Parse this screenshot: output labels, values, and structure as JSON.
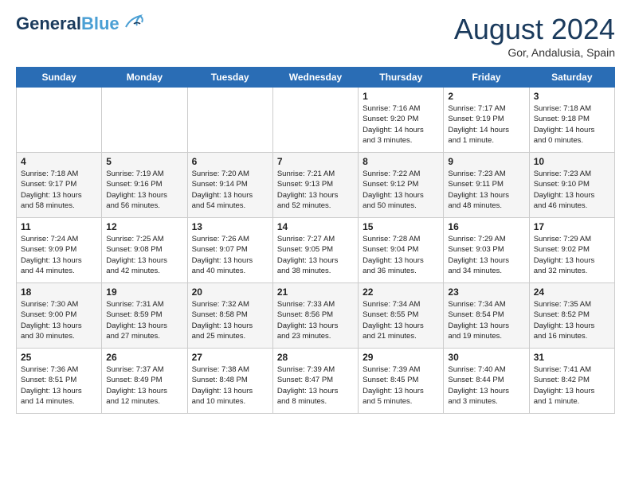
{
  "logo": {
    "general": "General",
    "blue": "Blue"
  },
  "title": {
    "month_year": "August 2024",
    "location": "Gor, Andalusia, Spain"
  },
  "days_of_week": [
    "Sunday",
    "Monday",
    "Tuesday",
    "Wednesday",
    "Thursday",
    "Friday",
    "Saturday"
  ],
  "weeks": [
    [
      {
        "day": "",
        "info": ""
      },
      {
        "day": "",
        "info": ""
      },
      {
        "day": "",
        "info": ""
      },
      {
        "day": "",
        "info": ""
      },
      {
        "day": "1",
        "info": "Sunrise: 7:16 AM\nSunset: 9:20 PM\nDaylight: 14 hours\nand 3 minutes."
      },
      {
        "day": "2",
        "info": "Sunrise: 7:17 AM\nSunset: 9:19 PM\nDaylight: 14 hours\nand 1 minute."
      },
      {
        "day": "3",
        "info": "Sunrise: 7:18 AM\nSunset: 9:18 PM\nDaylight: 14 hours\nand 0 minutes."
      }
    ],
    [
      {
        "day": "4",
        "info": "Sunrise: 7:18 AM\nSunset: 9:17 PM\nDaylight: 13 hours\nand 58 minutes."
      },
      {
        "day": "5",
        "info": "Sunrise: 7:19 AM\nSunset: 9:16 PM\nDaylight: 13 hours\nand 56 minutes."
      },
      {
        "day": "6",
        "info": "Sunrise: 7:20 AM\nSunset: 9:14 PM\nDaylight: 13 hours\nand 54 minutes."
      },
      {
        "day": "7",
        "info": "Sunrise: 7:21 AM\nSunset: 9:13 PM\nDaylight: 13 hours\nand 52 minutes."
      },
      {
        "day": "8",
        "info": "Sunrise: 7:22 AM\nSunset: 9:12 PM\nDaylight: 13 hours\nand 50 minutes."
      },
      {
        "day": "9",
        "info": "Sunrise: 7:23 AM\nSunset: 9:11 PM\nDaylight: 13 hours\nand 48 minutes."
      },
      {
        "day": "10",
        "info": "Sunrise: 7:23 AM\nSunset: 9:10 PM\nDaylight: 13 hours\nand 46 minutes."
      }
    ],
    [
      {
        "day": "11",
        "info": "Sunrise: 7:24 AM\nSunset: 9:09 PM\nDaylight: 13 hours\nand 44 minutes."
      },
      {
        "day": "12",
        "info": "Sunrise: 7:25 AM\nSunset: 9:08 PM\nDaylight: 13 hours\nand 42 minutes."
      },
      {
        "day": "13",
        "info": "Sunrise: 7:26 AM\nSunset: 9:07 PM\nDaylight: 13 hours\nand 40 minutes."
      },
      {
        "day": "14",
        "info": "Sunrise: 7:27 AM\nSunset: 9:05 PM\nDaylight: 13 hours\nand 38 minutes."
      },
      {
        "day": "15",
        "info": "Sunrise: 7:28 AM\nSunset: 9:04 PM\nDaylight: 13 hours\nand 36 minutes."
      },
      {
        "day": "16",
        "info": "Sunrise: 7:29 AM\nSunset: 9:03 PM\nDaylight: 13 hours\nand 34 minutes."
      },
      {
        "day": "17",
        "info": "Sunrise: 7:29 AM\nSunset: 9:02 PM\nDaylight: 13 hours\nand 32 minutes."
      }
    ],
    [
      {
        "day": "18",
        "info": "Sunrise: 7:30 AM\nSunset: 9:00 PM\nDaylight: 13 hours\nand 30 minutes."
      },
      {
        "day": "19",
        "info": "Sunrise: 7:31 AM\nSunset: 8:59 PM\nDaylight: 13 hours\nand 27 minutes."
      },
      {
        "day": "20",
        "info": "Sunrise: 7:32 AM\nSunset: 8:58 PM\nDaylight: 13 hours\nand 25 minutes."
      },
      {
        "day": "21",
        "info": "Sunrise: 7:33 AM\nSunset: 8:56 PM\nDaylight: 13 hours\nand 23 minutes."
      },
      {
        "day": "22",
        "info": "Sunrise: 7:34 AM\nSunset: 8:55 PM\nDaylight: 13 hours\nand 21 minutes."
      },
      {
        "day": "23",
        "info": "Sunrise: 7:34 AM\nSunset: 8:54 PM\nDaylight: 13 hours\nand 19 minutes."
      },
      {
        "day": "24",
        "info": "Sunrise: 7:35 AM\nSunset: 8:52 PM\nDaylight: 13 hours\nand 16 minutes."
      }
    ],
    [
      {
        "day": "25",
        "info": "Sunrise: 7:36 AM\nSunset: 8:51 PM\nDaylight: 13 hours\nand 14 minutes."
      },
      {
        "day": "26",
        "info": "Sunrise: 7:37 AM\nSunset: 8:49 PM\nDaylight: 13 hours\nand 12 minutes."
      },
      {
        "day": "27",
        "info": "Sunrise: 7:38 AM\nSunset: 8:48 PM\nDaylight: 13 hours\nand 10 minutes."
      },
      {
        "day": "28",
        "info": "Sunrise: 7:39 AM\nSunset: 8:47 PM\nDaylight: 13 hours\nand 8 minutes."
      },
      {
        "day": "29",
        "info": "Sunrise: 7:39 AM\nSunset: 8:45 PM\nDaylight: 13 hours\nand 5 minutes."
      },
      {
        "day": "30",
        "info": "Sunrise: 7:40 AM\nSunset: 8:44 PM\nDaylight: 13 hours\nand 3 minutes."
      },
      {
        "day": "31",
        "info": "Sunrise: 7:41 AM\nSunset: 8:42 PM\nDaylight: 13 hours\nand 1 minute."
      }
    ]
  ]
}
